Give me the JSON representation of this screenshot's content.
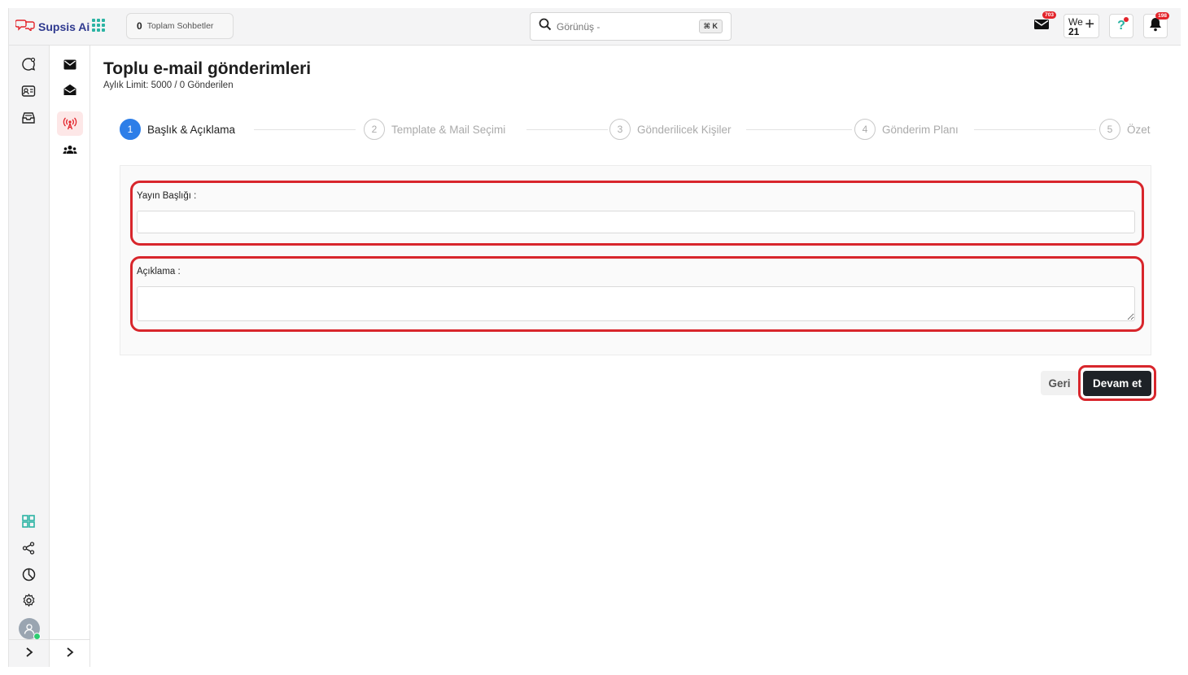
{
  "app": {
    "name": "Supsis Ai"
  },
  "topbar": {
    "conversations_count": "0",
    "conversations_label": "Toplam Sohbetler",
    "search_placeholder": "Görünüş -",
    "search_shortcut": "⌘ K",
    "mail_badge": "703",
    "calendar_day": "We",
    "calendar_date": "21",
    "calendar_plus": "+",
    "notif_badge": "198"
  },
  "page": {
    "title": "Toplu e-mail gönderimleri",
    "subtitle": "Aylık Limit: 5000 / 0 Gönderilen"
  },
  "steps": [
    {
      "num": "1",
      "label": "Başlık & Açıklama",
      "active": true
    },
    {
      "num": "2",
      "label": "Template & Mail Seçimi",
      "active": false
    },
    {
      "num": "3",
      "label": "Gönderilicek Kişiler",
      "active": false
    },
    {
      "num": "4",
      "label": "Gönderim Planı",
      "active": false
    },
    {
      "num": "5",
      "label": "Özet",
      "active": false
    }
  ],
  "form": {
    "title_label": "Yayın Başlığı :",
    "title_value": "",
    "description_label": "Açıklama :",
    "description_value": ""
  },
  "actions": {
    "back_label": "Geri",
    "next_label": "Devam et"
  },
  "colors": {
    "accent_blue": "#2d7ee8",
    "highlight_red": "#d8262c",
    "brand_navy": "#2f3a8f",
    "brand_teal": "#2bb3a3"
  }
}
